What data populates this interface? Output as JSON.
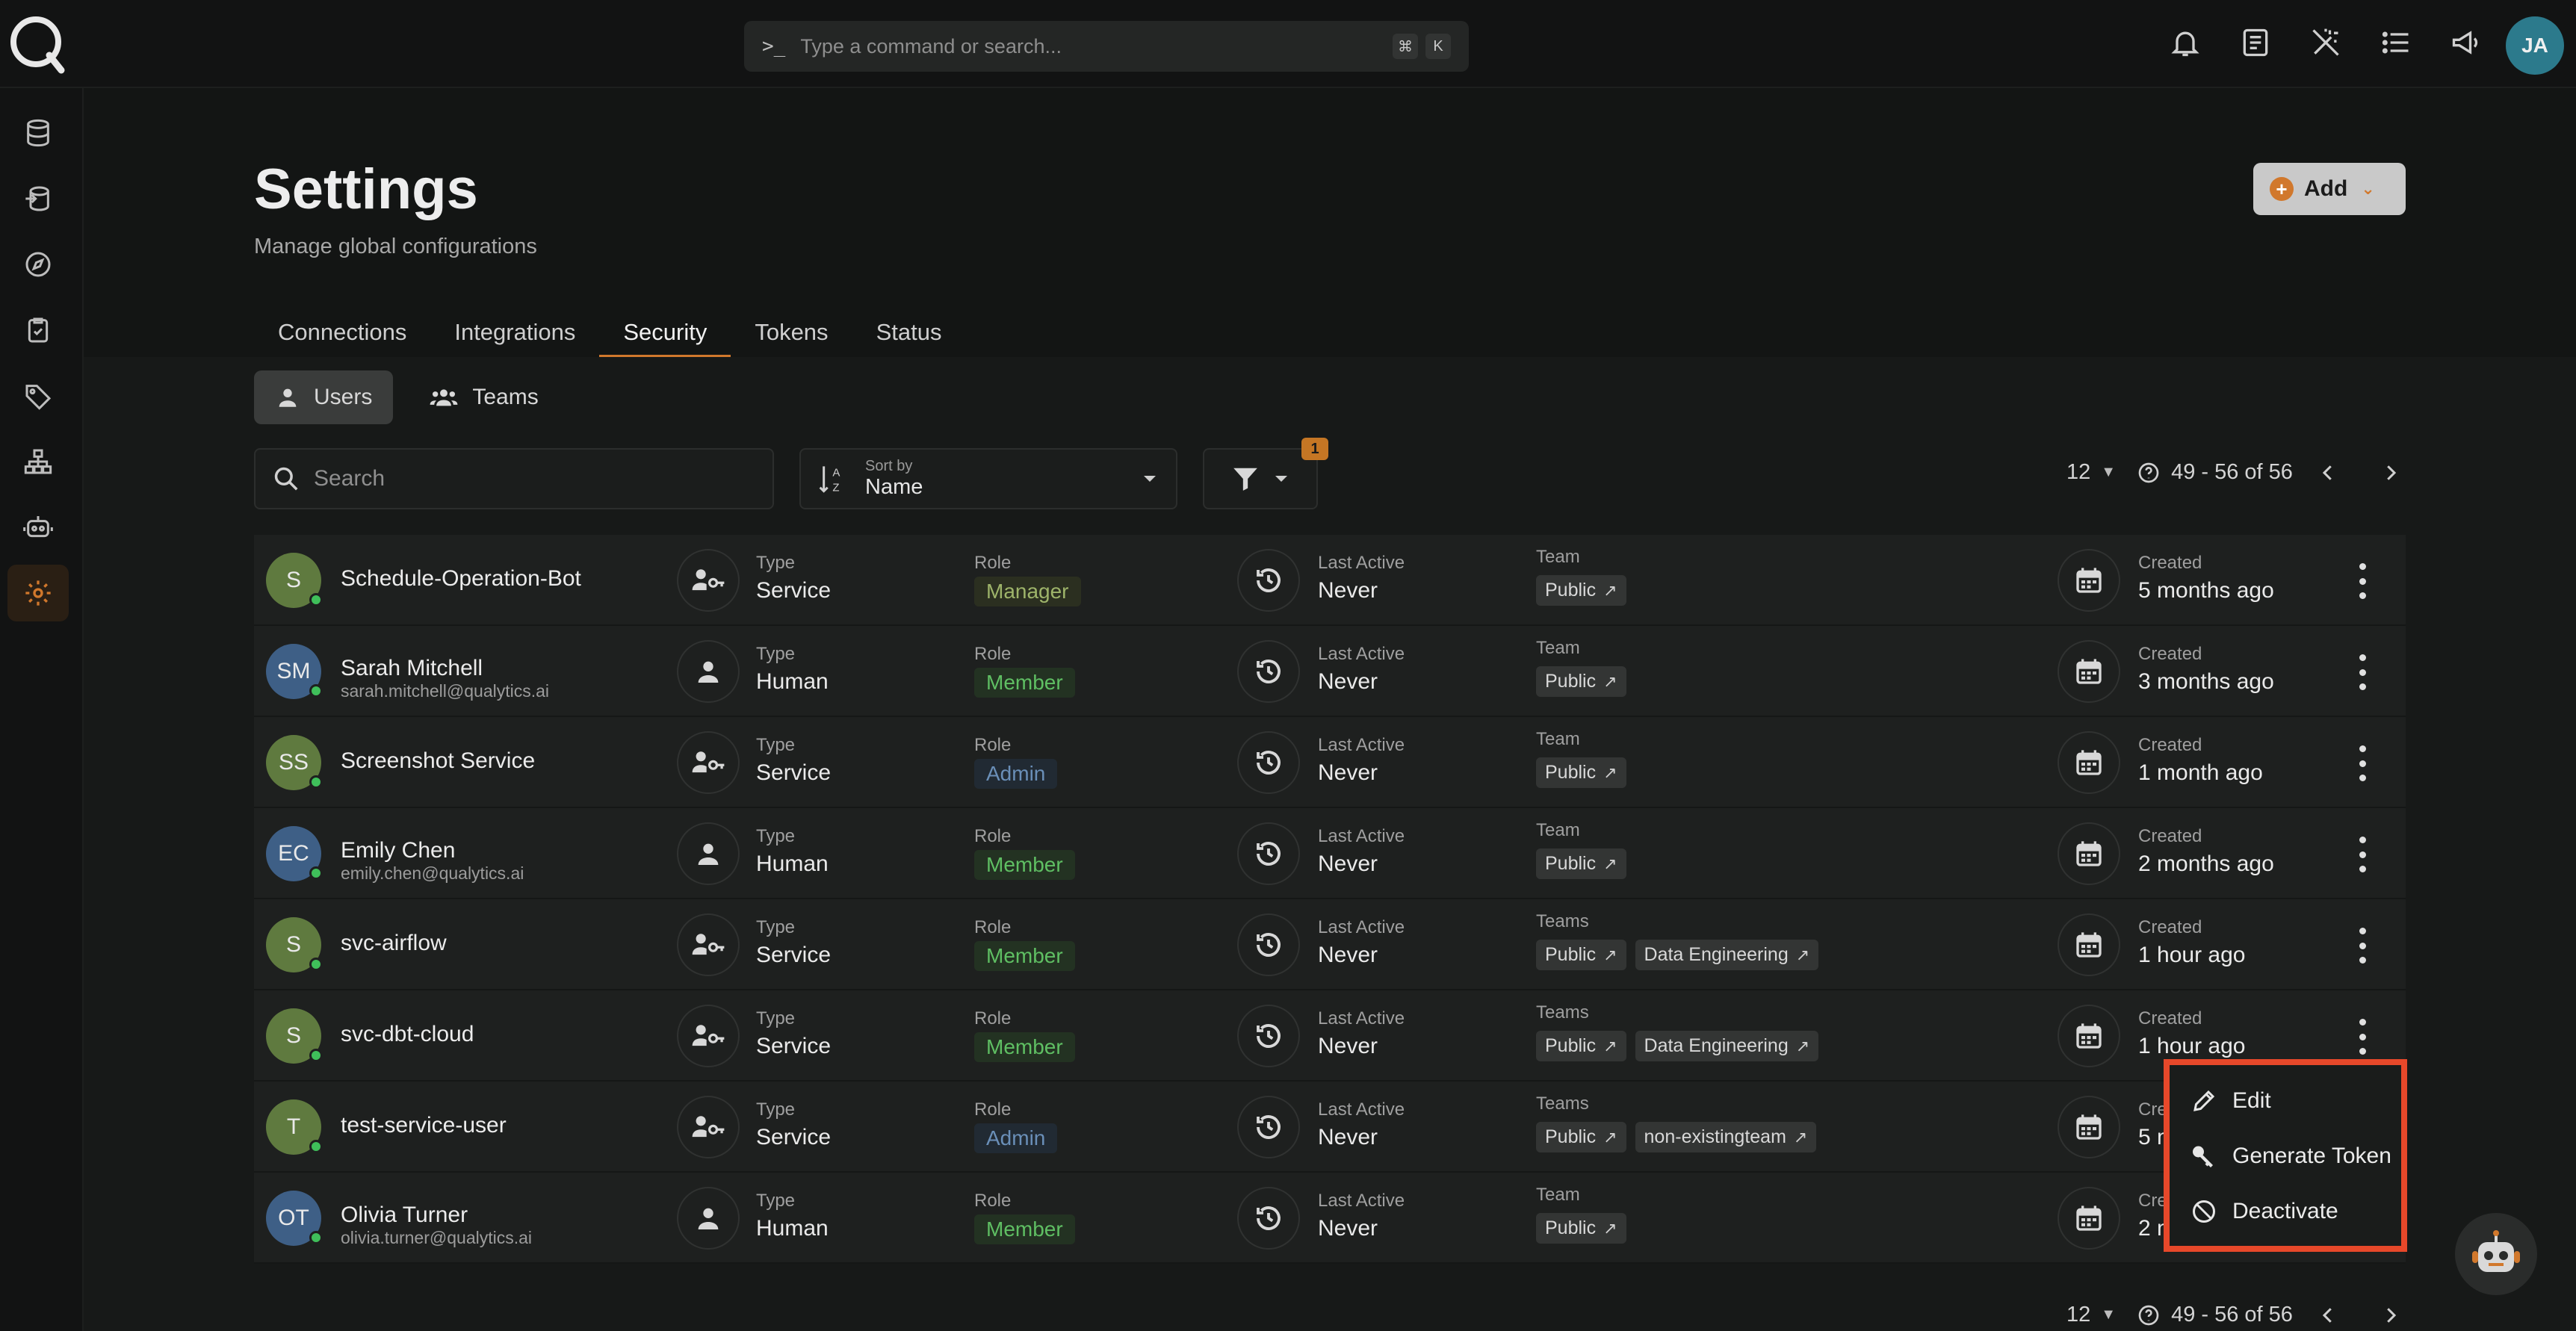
{
  "command_bar": {
    "placeholder": "Type a command or search...",
    "key1": "⌘",
    "key2": "K"
  },
  "user": {
    "initials": "JA"
  },
  "page": {
    "title": "Settings",
    "subtitle": "Manage global configurations",
    "add_label": "Add"
  },
  "tabs": [
    {
      "label": "Connections"
    },
    {
      "label": "Integrations"
    },
    {
      "label": "Security"
    },
    {
      "label": "Tokens"
    },
    {
      "label": "Status"
    }
  ],
  "segments": {
    "users": "Users",
    "teams": "Teams"
  },
  "toolbar": {
    "search_placeholder": "Search",
    "sort_small": "Sort by",
    "sort_value": "Name",
    "filter_count": "1"
  },
  "pager_top": {
    "size": "12",
    "range": "49 - 56 of 56"
  },
  "pager_bottom": {
    "size": "12",
    "range": "49 - 56 of 56"
  },
  "labels": {
    "type": "Type",
    "role": "Role",
    "last_active": "Last Active",
    "created": "Created",
    "team": "Team",
    "teams": "Teams"
  },
  "rows": [
    {
      "initials": "S",
      "name": "Schedule-Operation-Bot",
      "email": "",
      "type": "Service",
      "role": "Manager",
      "last": "Never",
      "team_label": "Team",
      "teams": [
        "Public"
      ],
      "created": "5 months ago"
    },
    {
      "initials": "SM",
      "name": "Sarah Mitchell",
      "email": "sarah.mitchell@qualytics.ai",
      "type": "Human",
      "role": "Member",
      "last": "Never",
      "team_label": "Team",
      "teams": [
        "Public"
      ],
      "created": "3 months ago"
    },
    {
      "initials": "SS",
      "name": "Screenshot Service",
      "email": "",
      "type": "Service",
      "role": "Admin",
      "last": "Never",
      "team_label": "Team",
      "teams": [
        "Public"
      ],
      "created": "1 month ago"
    },
    {
      "initials": "EC",
      "name": "Emily Chen",
      "email": "emily.chen@qualytics.ai",
      "type": "Human",
      "role": "Member",
      "last": "Never",
      "team_label": "Team",
      "teams": [
        "Public"
      ],
      "created": "2 months ago"
    },
    {
      "initials": "S",
      "name": "svc-airflow",
      "email": "",
      "type": "Service",
      "role": "Member",
      "last": "Never",
      "team_label": "Teams",
      "teams": [
        "Public",
        "Data Engineering"
      ],
      "created": "1 hour ago"
    },
    {
      "initials": "S",
      "name": "svc-dbt-cloud",
      "email": "",
      "type": "Service",
      "role": "Member",
      "last": "Never",
      "team_label": "Teams",
      "teams": [
        "Public",
        "Data Engineering"
      ],
      "created": "1 hour ago"
    },
    {
      "initials": "T",
      "name": "test-service-user",
      "email": "",
      "type": "Service",
      "role": "Admin",
      "last": "Never",
      "team_label": "Teams",
      "teams": [
        "Public",
        "non-existingteam"
      ],
      "created": "5 m"
    },
    {
      "initials": "OT",
      "name": "Olivia Turner",
      "email": "olivia.turner@qualytics.ai",
      "type": "Human",
      "role": "Member",
      "last": "Never",
      "team_label": "Team",
      "teams": [
        "Public"
      ],
      "created": "2 m"
    }
  ],
  "menu": {
    "edit": "Edit",
    "token": "Generate Token",
    "deactivate": "Deactivate"
  },
  "colors": {
    "accent": "#d1782c",
    "highlight": "#e7482a",
    "service_avatar": "#5f7a3f",
    "human_avatar": "#3e5f86"
  }
}
